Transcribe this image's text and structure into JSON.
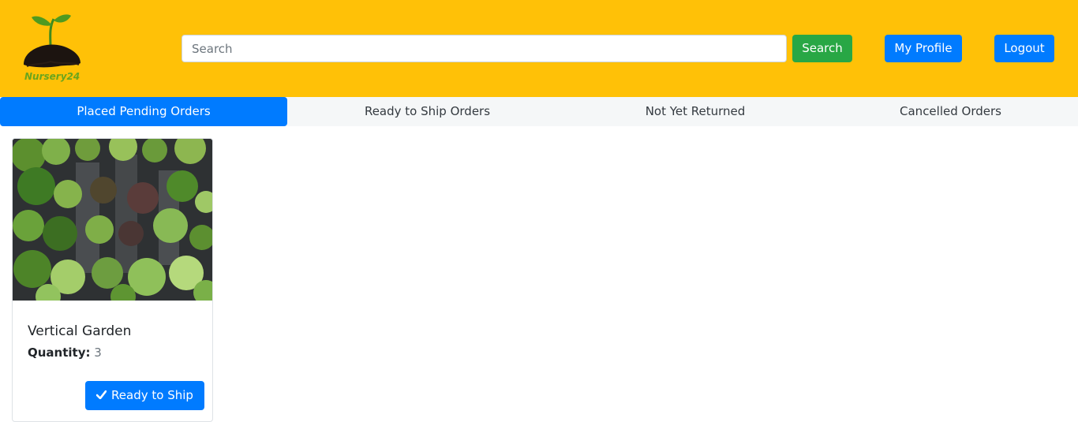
{
  "header": {
    "logo_text": "Nursery24",
    "search_placeholder": "Search",
    "search_value": "",
    "search_button": "Search",
    "profile_button": "My Profile",
    "logout_button": "Logout",
    "background_color": "#ffc107"
  },
  "tabs": [
    {
      "label": "Placed Pending Orders",
      "active": true
    },
    {
      "label": "Ready to Ship Orders",
      "active": false
    },
    {
      "label": "Not Yet Returned",
      "active": false
    },
    {
      "label": "Cancelled Orders",
      "active": false
    }
  ],
  "orders": [
    {
      "name": "Vertical Garden",
      "quantity_label": "Quantity:",
      "quantity": "3",
      "action_label": "Ready to Ship",
      "action_icon": "check-icon"
    }
  ],
  "colors": {
    "primary": "#007bff",
    "success": "#28a745",
    "brand_green": "#6aa51e"
  }
}
